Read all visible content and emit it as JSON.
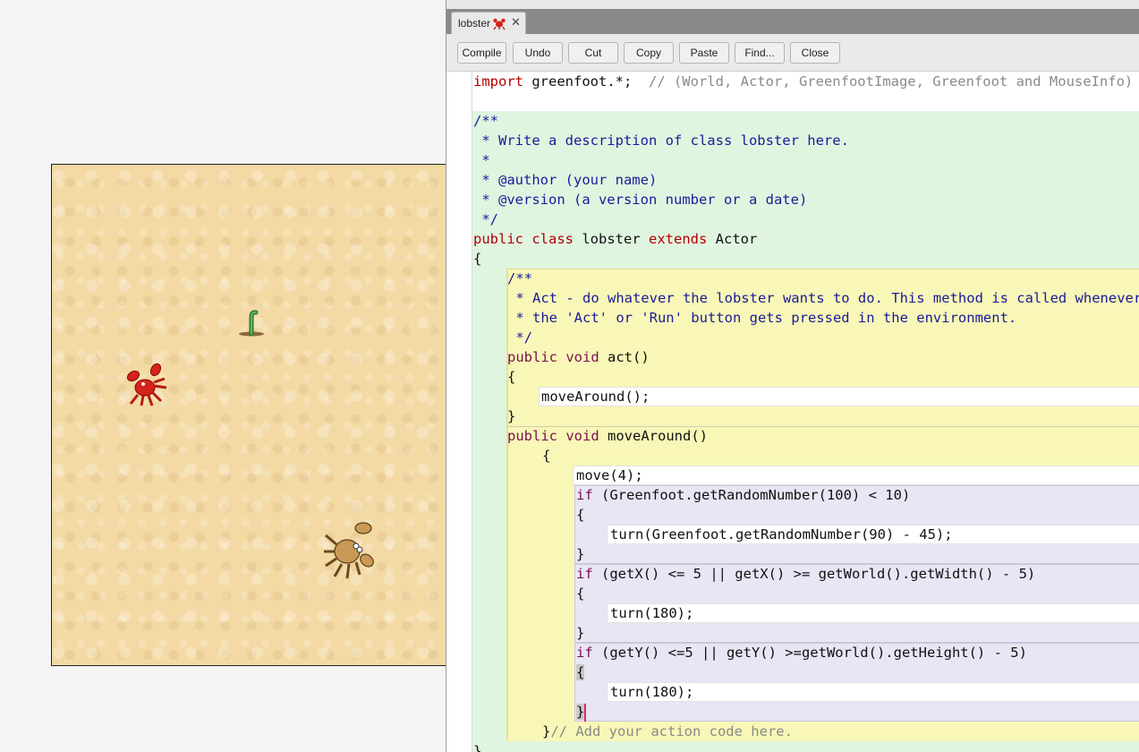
{
  "editor": {
    "tab": {
      "label": "lobster",
      "icon": "lobster-icon",
      "close_icon": "close-icon"
    },
    "toolbar": {
      "buttons": [
        "Compile",
        "Undo",
        "Cut",
        "Copy",
        "Paste",
        "Find...",
        "Close"
      ]
    },
    "lines": {
      "l1_kw": "import",
      "l1_rest": " greenfoot.*;  ",
      "l1_comment": "// (World, Actor, GreenfootImage, Greenfoot and MouseInfo)",
      "c1": "/**",
      "c2": " * Write a description of class lobster here.",
      "c3": " * ",
      "c4": " * @author (your name) ",
      "c5": " * @version (a version number or a date)",
      "c6": " */",
      "decl_kw1": "public",
      "decl_kw2": "class",
      "decl_name": " lobster ",
      "decl_kw3": "extends",
      "decl_super": " Actor",
      "brace_open": "{",
      "m1c1": "/**",
      "m1c2": " * Act - do whatever the lobster wants to do. This method is called whenever",
      "m1c3": " * the 'Act' or 'Run' button gets pressed in the environment.",
      "m1c4": " */",
      "m1_kw1": "public",
      "m1_kw2": "void",
      "m1_name": " act()",
      "m1_open": "{",
      "m1_body": "moveAround();",
      "m1_close": "}",
      "m2_kw1": "public",
      "m2_kw2": "void",
      "m2_name": " moveAround()",
      "m2_open": "{",
      "s_move": "move(4);",
      "if1_kw": "if",
      "if1_cond": " (Greenfoot.getRandomNumber(100) < 10)",
      "if1_open": "{",
      "if1_body": "turn(Greenfoot.getRandomNumber(90) - 45);",
      "if1_close": "}",
      "if2_kw": "if",
      "if2_cond": " (getX() <= 5 || getX() >= getWorld().getWidth() - 5)",
      "if2_open": "{",
      "if2_body": "turn(180);",
      "if2_close": "}",
      "if3_kw": "if",
      "if3_cond": " (getY() <=5 || getY() >=getWorld().getHeight() - 5)",
      "if3_open": "{",
      "if3_body": "turn(180);",
      "if3_close": "}",
      "m2_close": "}",
      "m2_trail": "// Add your action code here.",
      "brace_close": "}"
    }
  },
  "world": {
    "actors": [
      "worm-icon",
      "lobster-icon",
      "crab-icon"
    ]
  }
}
